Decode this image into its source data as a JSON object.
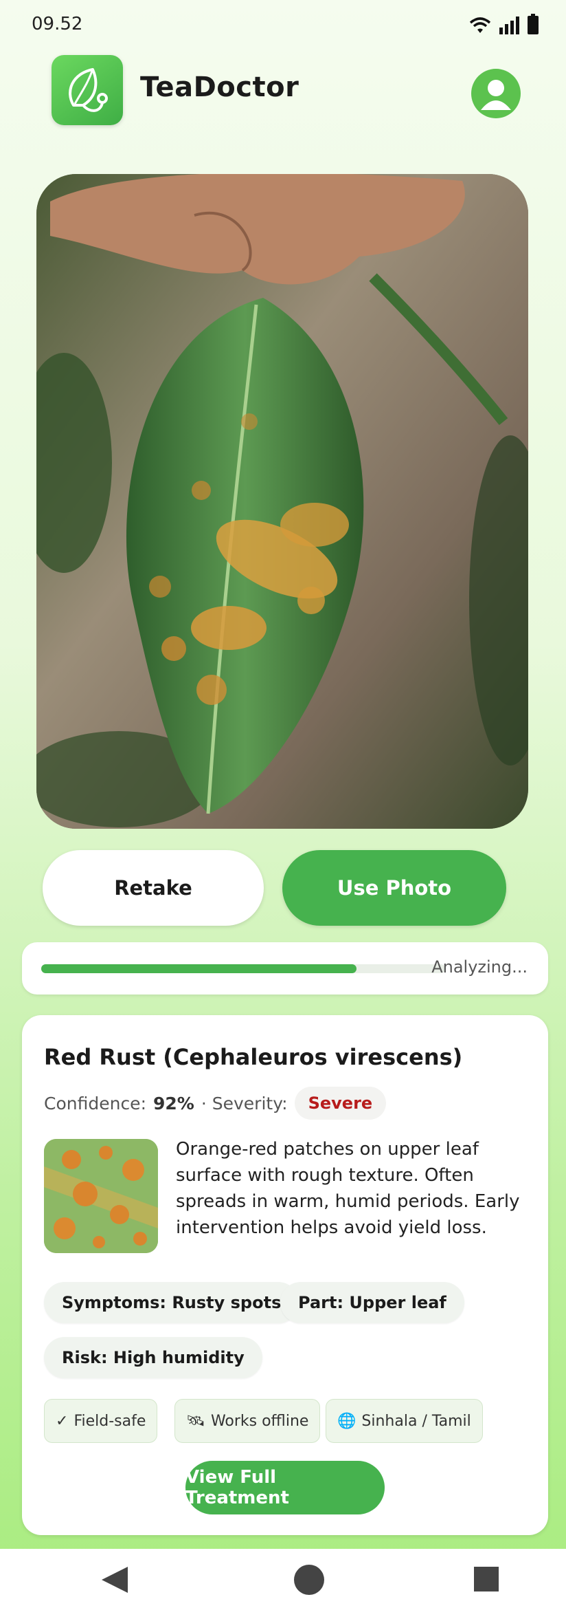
{
  "status": {
    "time": "09.52"
  },
  "app": {
    "title": "TeaDoctor"
  },
  "buttons": {
    "retake": "Retake",
    "use_photo": "Use Photo"
  },
  "analysis": {
    "progress": 0.78,
    "status_text": "Analyzing..."
  },
  "result": {
    "title": "Red Rust (Cephaleuros virescens)",
    "confidence_label": "Confidence:",
    "confidence_value": "92%",
    "severity_label": "· Severity:",
    "severity_value": "Severe",
    "description": "Orange-red patches on upper leaf surface with rough texture. Often spreads in warm, humid periods. Early intervention helps avoid yield loss.",
    "chips": [
      {
        "label": "Symptoms: Rusty spots"
      },
      {
        "label": "Part: Upper leaf"
      },
      {
        "label": "Risk: High humidity"
      }
    ],
    "tags": [
      {
        "icon": "✓",
        "label": "Field-safe"
      },
      {
        "icon": "🛰",
        "label": "Works offline"
      },
      {
        "icon": "🌐",
        "label": "Sinhala / Tamil"
      }
    ],
    "view_button": "View Full Treatment"
  },
  "colors": {
    "primary": "#46B24E",
    "severity": "#B71C1C"
  }
}
